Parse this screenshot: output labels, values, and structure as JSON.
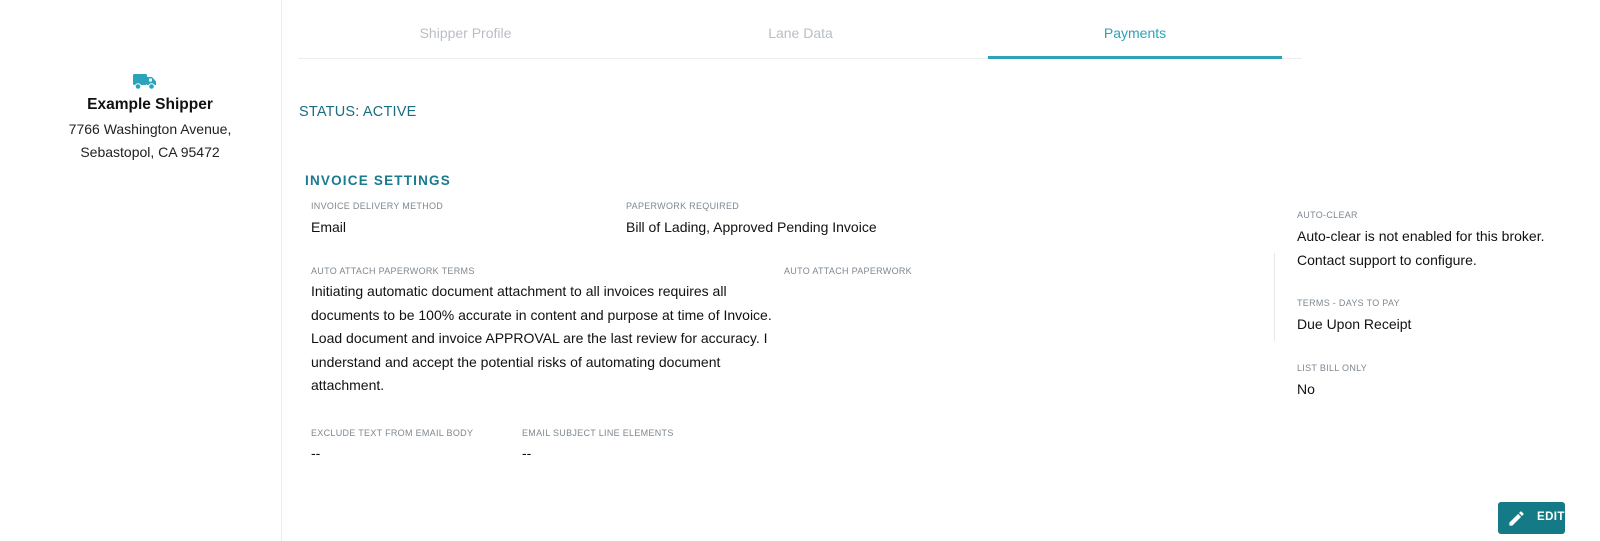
{
  "shipper": {
    "name": "Example Shipper",
    "address_line1": "7766 Washington Avenue,",
    "address_line2": "Sebastopol, CA 95472",
    "icon": "truck-icon"
  },
  "tabs": [
    {
      "label": "Shipper Profile",
      "active": false
    },
    {
      "label": "Lane Data",
      "active": false
    },
    {
      "label": "Payments",
      "active": true
    }
  ],
  "status": "STATUS: ACTIVE",
  "invoice_settings": {
    "title": "INVOICE SETTINGS",
    "delivery_method": {
      "label": "INVOICE DELIVERY METHOD",
      "value": "Email"
    },
    "paperwork_required": {
      "label": "PAPERWORK REQUIRED",
      "value": "Bill of Lading, Approved Pending Invoice"
    },
    "auto_attach_terms": {
      "label": "AUTO ATTACH PAPERWORK TERMS",
      "lines": [
        "Initiating automatic document attachment to all invoices requires all",
        "documents to be 100% accurate in content and purpose at time of Invoice.",
        "Load document and invoice APPROVAL are the last review for accuracy. I",
        "understand and accept the potential risks of automating document",
        "attachment."
      ]
    },
    "auto_attach_paperwork": {
      "label": "AUTO ATTACH PAPERWORK",
      "value": ""
    },
    "exclude_text": {
      "label": "EXCLUDE TEXT FROM EMAIL BODY",
      "value": "--"
    },
    "subject_elements": {
      "label": "EMAIL SUBJECT LINE ELEMENTS",
      "value": "--"
    }
  },
  "right_panel": {
    "auto_clear": {
      "label": "AUTO-CLEAR",
      "line1": "Auto-clear is not enabled for this broker.",
      "line2": "Contact support to configure."
    },
    "terms": {
      "label": "TERMS - DAYS TO PAY",
      "value": "Due Upon Receipt"
    },
    "list_bill": {
      "label": "LIST BILL ONLY",
      "value": "No"
    }
  },
  "edit_button": {
    "label": "EDIT",
    "icon": "pencil-icon"
  },
  "colors": {
    "accent": "#2aa3bb",
    "section_title": "#1a7a8f",
    "status_text": "#1c6c82",
    "edit_button": "#137a86",
    "inactive_tab": "#b9bec4"
  }
}
